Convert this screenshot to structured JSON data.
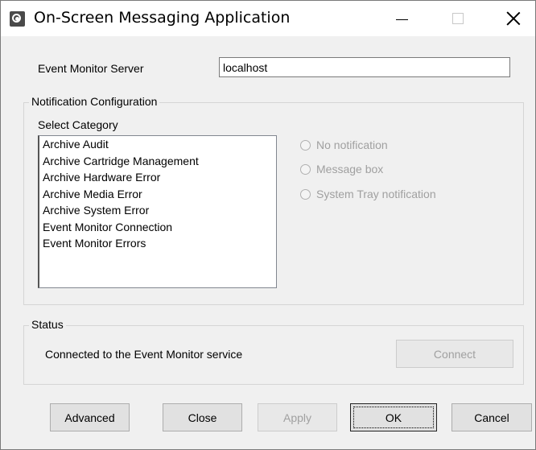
{
  "window": {
    "title": "On-Screen Messaging Application",
    "controls": {
      "minimize": "minimize",
      "maximize": "maximize",
      "close": "close"
    }
  },
  "server": {
    "label": "Event Monitor Server",
    "value": "localhost"
  },
  "notification": {
    "group_title": "Notification Configuration",
    "category_label": "Select Category",
    "categories": [
      "Archive Audit",
      "Archive Cartridge Management",
      "Archive Hardware Error",
      "Archive Media Error",
      "Archive System Error",
      "Event Monitor Connection",
      "Event Monitor Errors"
    ],
    "options": [
      {
        "label": "No notification",
        "enabled": false
      },
      {
        "label": "Message box",
        "enabled": false
      },
      {
        "label": "System Tray notification",
        "enabled": false
      }
    ]
  },
  "status": {
    "group_title": "Status",
    "text": "Connected to the Event Monitor service",
    "connect_label": "Connect"
  },
  "buttons": {
    "advanced": "Advanced",
    "close": "Close",
    "apply": "Apply",
    "ok": "OK",
    "cancel": "Cancel"
  }
}
